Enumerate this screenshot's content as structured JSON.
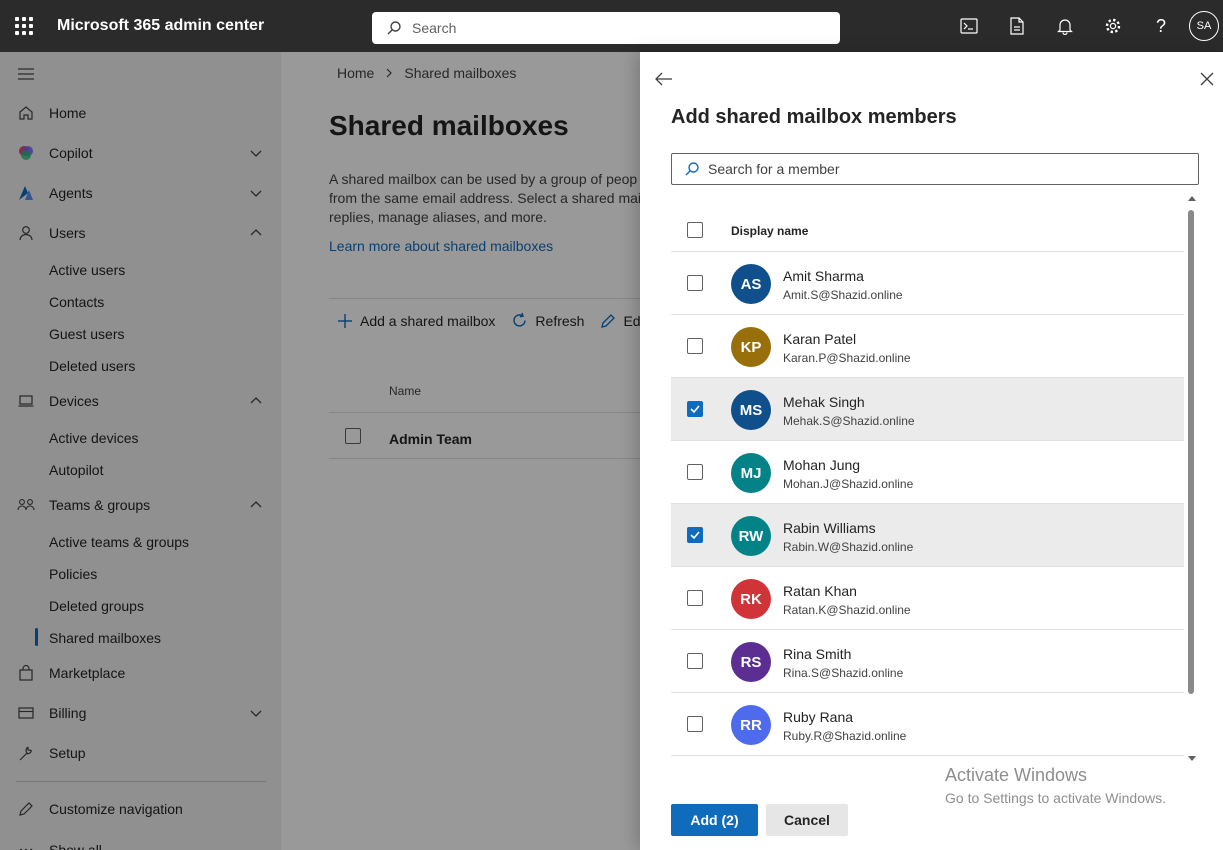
{
  "topbar": {
    "app_title": "Microsoft 365 admin center",
    "search_placeholder": "Search",
    "user_initials": "SA"
  },
  "leftnav": {
    "items": [
      {
        "label": "Home"
      },
      {
        "label": "Copilot"
      },
      {
        "label": "Agents"
      },
      {
        "label": "Users"
      },
      {
        "label": "Devices"
      },
      {
        "label": "Teams & groups"
      },
      {
        "label": "Marketplace"
      },
      {
        "label": "Billing"
      },
      {
        "label": "Setup"
      },
      {
        "label": "Customize navigation"
      },
      {
        "label": "Show all"
      }
    ],
    "users_sub": [
      "Active users",
      "Contacts",
      "Guest users",
      "Deleted users"
    ],
    "devices_sub": [
      "Active devices",
      "Autopilot"
    ],
    "teams_sub": [
      "Active teams & groups",
      "Policies",
      "Deleted groups",
      "Shared mailboxes"
    ],
    "active_item": "Shared mailboxes"
  },
  "main": {
    "breadcrumb": [
      "Home",
      "Shared mailboxes"
    ],
    "title": "Shared mailboxes",
    "description": "A shared mailbox can be used by a group of peop from the same email address. Select a shared maill replies, manage aliases, and more.",
    "learn_more": "Learn more about shared mailboxes",
    "commands": {
      "add": "Add a shared mailbox",
      "refresh": "Refresh",
      "edit": "Edi"
    },
    "table": {
      "column": "Name",
      "rows": [
        "Admin Team"
      ]
    }
  },
  "panel": {
    "title": "Add shared mailbox members",
    "search_placeholder": "Search for a member",
    "column_header": "Display name",
    "members": [
      {
        "initials": "AS",
        "name": "Amit Sharma",
        "email": "Amit.S@Shazid.online",
        "color": "#0f4f8c",
        "checked": false
      },
      {
        "initials": "KP",
        "name": "Karan Patel",
        "email": "Karan.P@Shazid.online",
        "color": "#986f0b",
        "checked": false
      },
      {
        "initials": "MS",
        "name": "Mehak Singh",
        "email": "Mehak.S@Shazid.online",
        "color": "#0f4f8c",
        "checked": true
      },
      {
        "initials": "MJ",
        "name": "Mohan Jung",
        "email": "Mohan.J@Shazid.online",
        "color": "#038387",
        "checked": false
      },
      {
        "initials": "RW",
        "name": "Rabin Williams",
        "email": "Rabin.W@Shazid.online",
        "color": "#038387",
        "checked": true
      },
      {
        "initials": "RK",
        "name": "Ratan Khan",
        "email": "Ratan.K@Shazid.online",
        "color": "#d13438",
        "checked": false
      },
      {
        "initials": "RS",
        "name": "Rina Smith",
        "email": "Rina.S@Shazid.online",
        "color": "#5c2e91",
        "checked": false
      },
      {
        "initials": "RR",
        "name": "Ruby Rana",
        "email": "Ruby.R@Shazid.online",
        "color": "#4f6bed",
        "checked": false
      }
    ],
    "add_label": "Add (2)",
    "cancel_label": "Cancel"
  },
  "watermark": {
    "line1": "Activate Windows",
    "line2": "Go to Settings to activate Windows."
  },
  "colors": {
    "accent": "#0f6cbd",
    "topbar": "#2b2b2b"
  }
}
